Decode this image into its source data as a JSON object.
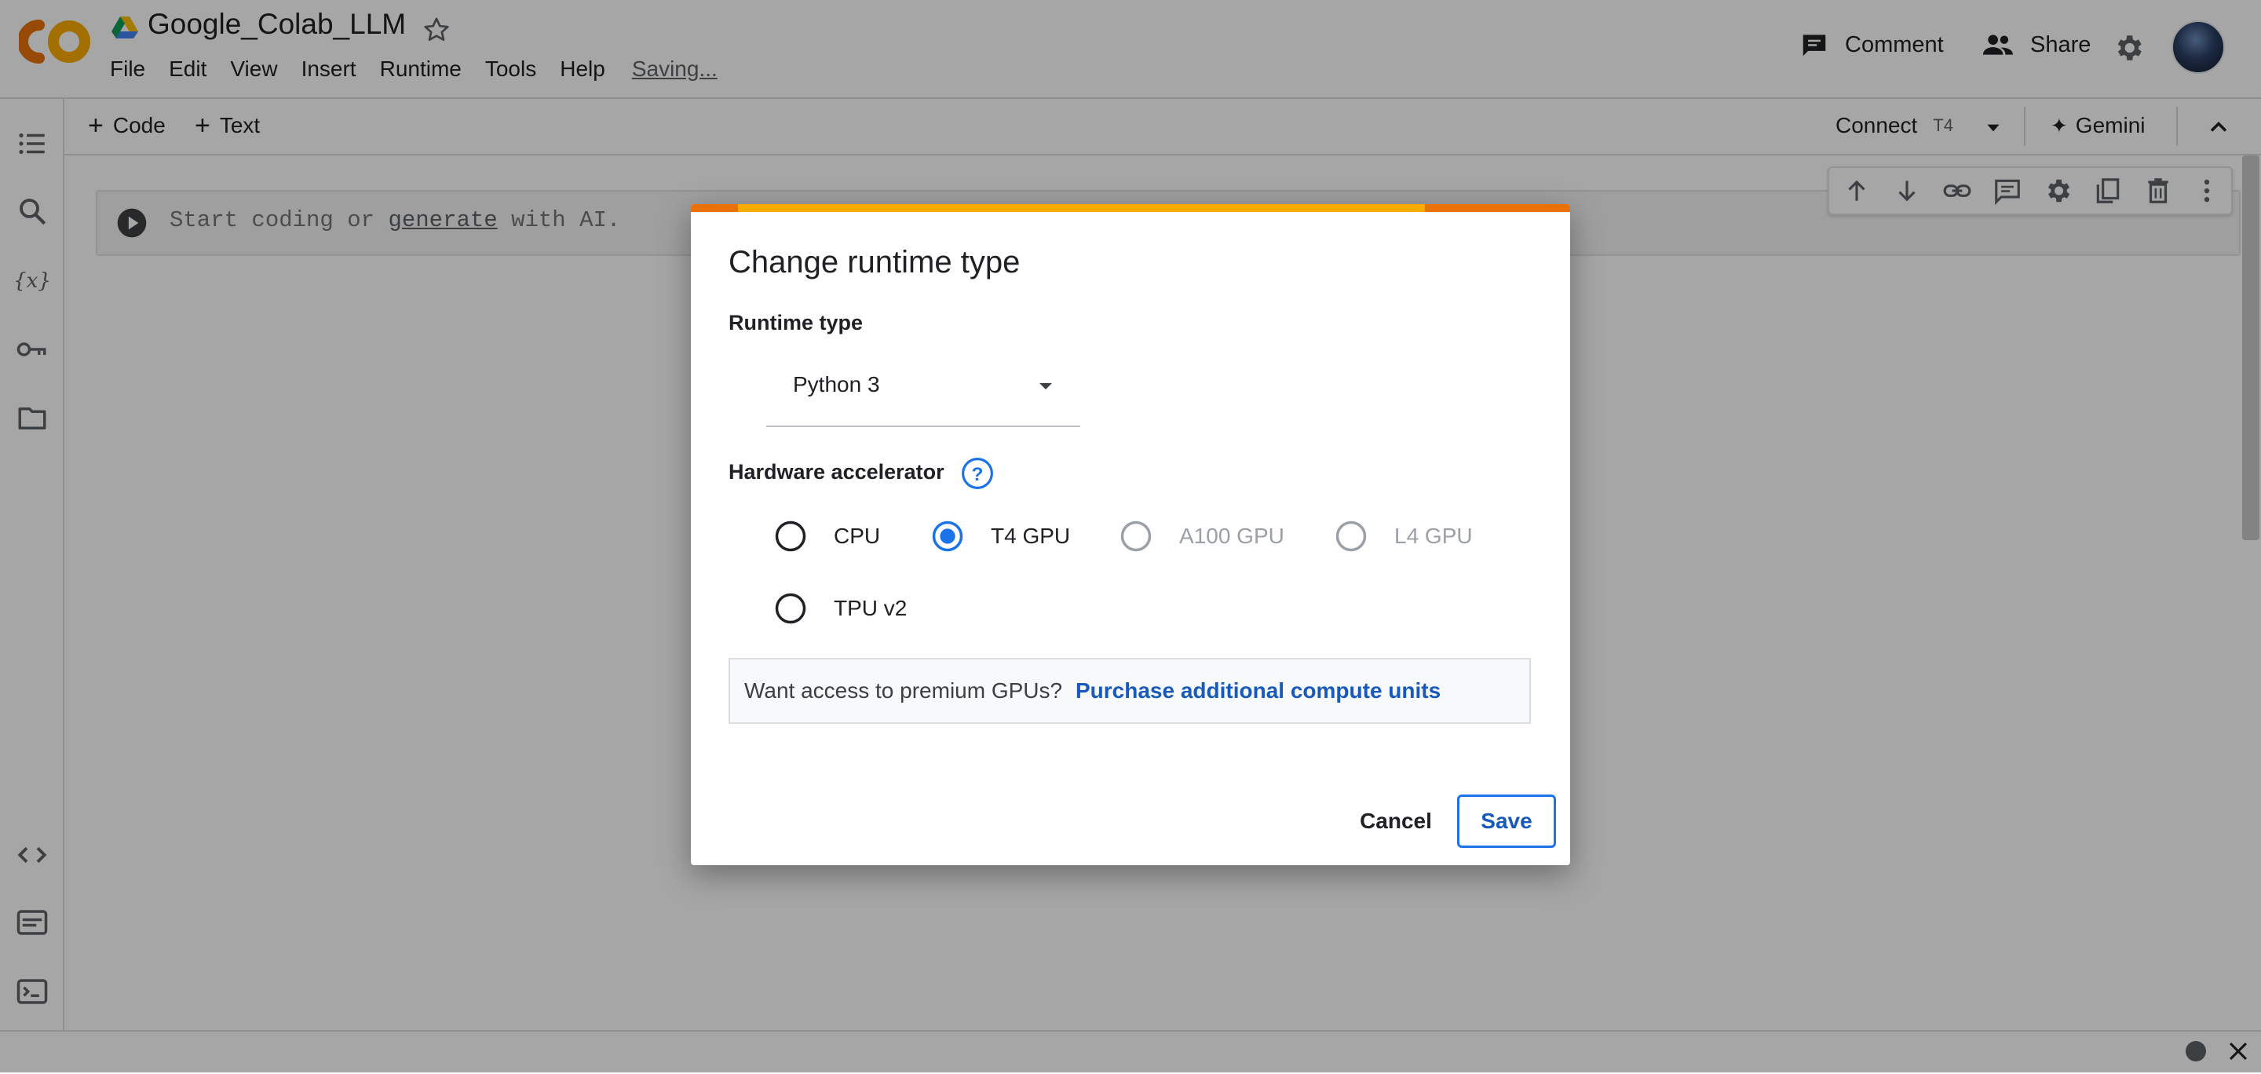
{
  "header": {
    "logo_text": "CO",
    "doc_title": "Google_Colab_LLM",
    "menu": [
      "File",
      "Edit",
      "View",
      "Insert",
      "Runtime",
      "Tools",
      "Help"
    ],
    "saving_label": "Saving...",
    "comment_label": "Comment",
    "share_label": "Share"
  },
  "toolbar": {
    "add_code_label": "Code",
    "add_text_label": "Text",
    "connect_label": "Connect",
    "runtime_badge": "T4",
    "gemini_label": "Gemini"
  },
  "cell": {
    "placeholder_prefix": "Start coding or ",
    "placeholder_link": "generate",
    "placeholder_suffix": " with AI."
  },
  "dialog": {
    "title": "Change runtime type",
    "runtime_type_label": "Runtime type",
    "runtime_type_value": "Python 3",
    "hardware_label": "Hardware accelerator",
    "accelerators": [
      {
        "label": "CPU",
        "selected": false,
        "disabled": false
      },
      {
        "label": "T4 GPU",
        "selected": true,
        "disabled": false
      },
      {
        "label": "A100 GPU",
        "selected": false,
        "disabled": true
      },
      {
        "label": "L4 GPU",
        "selected": false,
        "disabled": true
      },
      {
        "label": "TPU v2",
        "selected": false,
        "disabled": false
      }
    ],
    "promo_text": "Want access to premium GPUs?",
    "promo_link": "Purchase additional compute units",
    "cancel_label": "Cancel",
    "save_label": "Save"
  },
  "colors": {
    "accent_blue": "#1a73e8",
    "colab_orange": "#f9ab00",
    "colab_dark_orange": "#e8710a"
  }
}
